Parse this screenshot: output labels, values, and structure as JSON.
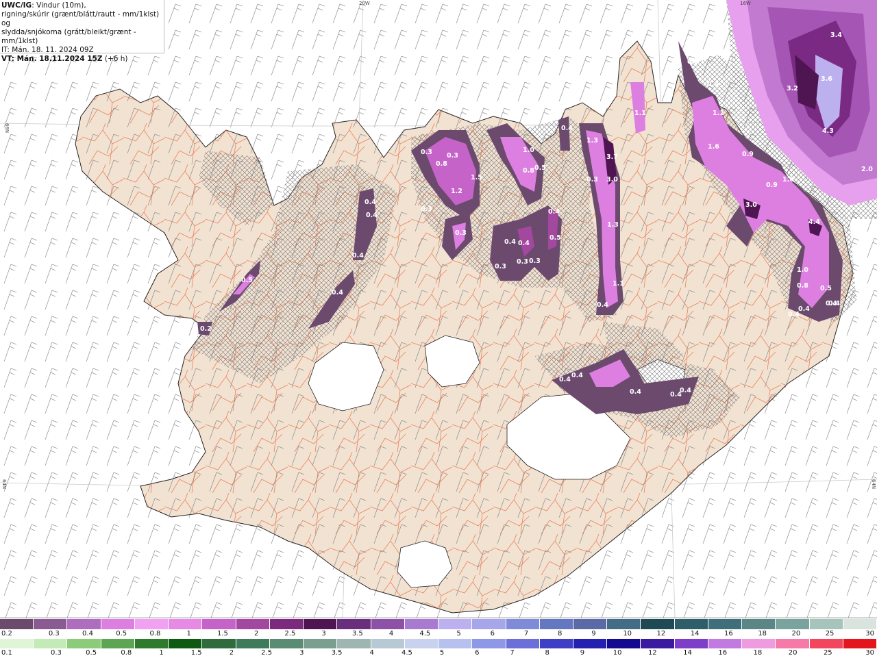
{
  "header": {
    "product": "UWC/IG",
    "line1_rest": ": Vindur (10m),",
    "line2": "rigning/skúrir (grænt/blátt/rautt - mm/1klst) og",
    "line3": "slydda/snjókoma (grátt/bleikt/grænt - mm/1klst)",
    "line4": "IT: Mán. 18. 11. 2024 09Z",
    "vt_label": "VT: Mán. 18.11.2024 15Z",
    "vt_offset": " (+6 h)"
  },
  "map_labels": {
    "lon_20w": "20W",
    "lon_16w": "16W",
    "lat_66n": "66N",
    "lat_64n_left": "64N",
    "lat_64n_right": "64N"
  },
  "precip_values": [
    "3.4",
    "3.6",
    "3.2",
    "4.3",
    "2.0",
    "0.3",
    "0.4",
    "1.1",
    "1.6",
    "0.9",
    "0.9",
    "1.6",
    "3.0",
    "4.4",
    "1.0",
    "0.8",
    "0.5",
    "0.4",
    "0.4",
    "0.4",
    "1.1",
    "0.4",
    "1.3",
    "3.7",
    "3.0",
    "0.3",
    "1.3",
    "1.1",
    "0.4",
    "1.0",
    "0.8",
    "0.5",
    "0.4",
    "0.5",
    "0.4",
    "0.4",
    "0.3",
    "0.3",
    "0.3",
    "0.3",
    "0.8",
    "0.3",
    "1.2",
    "1.5",
    "0.4",
    "0.3",
    "0.4",
    "0.4",
    "0.4",
    "0.3",
    "0.5",
    "0.2",
    "0.4",
    "0.4",
    "0.4",
    "0.4",
    "0.4",
    "0.4"
  ],
  "legend": {
    "top_ticks": [
      "0.2",
      "0.3",
      "0.4",
      "0.5",
      "0.8",
      "1",
      "1.5",
      "2",
      "2.5",
      "3",
      "3.5",
      "4",
      "4.5",
      "5",
      "6",
      "7",
      "8",
      "9",
      "10",
      "12",
      "14",
      "16",
      "18",
      "20",
      "25",
      "30"
    ],
    "bottom_ticks": [
      "0.1",
      "0.3",
      "0.5",
      "0.8",
      "1",
      "1.5",
      "2",
      "2.5",
      "3",
      "3.5",
      "4",
      "4.5",
      "5",
      "6",
      "7",
      "8",
      "9",
      "10",
      "12",
      "14",
      "16",
      "18",
      "20",
      "25",
      "30"
    ],
    "snow_colors": [
      "#6b4a6e",
      "#8a5a92",
      "#b06dc0",
      "#dd7fe0",
      "#f2a0f2",
      "#e68ae6",
      "#c563c8",
      "#a2489f",
      "#7b2a7d",
      "#4f1552",
      "#6a2f7c",
      "#8d52a8",
      "#a87bd0",
      "#bdb0ee",
      "#a7a6ea",
      "#7f8ad8",
      "#6478c2",
      "#5b6aa6",
      "#436c87",
      "#1f4a55",
      "#2f5e6b",
      "#3f6f7a",
      "#5a8786",
      "#7aa39e",
      "#a6c3bc",
      "#d9e4de"
    ],
    "rain_colors": [
      "#dff5d5",
      "#c4ebb7",
      "#8ccb7a",
      "#5ea553",
      "#2f7b2e",
      "#0f5a12",
      "#2f6b3d",
      "#3f7a5a",
      "#5a8b73",
      "#7a9e8f",
      "#9fb6b0",
      "#b8c9d6",
      "#c8d2ee",
      "#b7c1ef",
      "#8f98e6",
      "#6b6fd7",
      "#3e3fc4",
      "#2420b0",
      "#130a8f",
      "#3c1aa0",
      "#7e3fc8",
      "#c07ae0",
      "#ef9be0",
      "#f57aa8",
      "#f2465e",
      "#e2161c"
    ]
  }
}
